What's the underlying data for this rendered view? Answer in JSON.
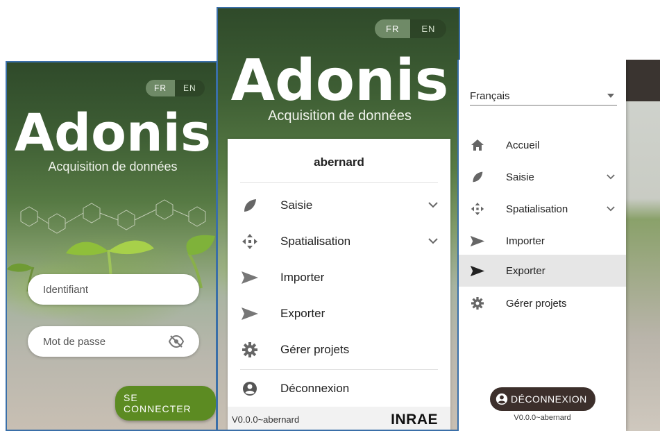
{
  "login": {
    "lang": [
      "FR",
      "EN"
    ],
    "brand": "Adonis",
    "tagline": "Acquisition de données",
    "username_placeholder": "Identifiant",
    "password_placeholder": "Mot de passe",
    "connect_label": "SE CONNECTER"
  },
  "drawer": {
    "lang": [
      "FR",
      "EN"
    ],
    "brand": "Adonis",
    "tagline": "Acquisition de données",
    "username": "abernard",
    "items": [
      {
        "label": "Saisie"
      },
      {
        "label": "Spatialisation"
      },
      {
        "label": "Importer"
      },
      {
        "label": "Exporter"
      },
      {
        "label": "Gérer projets"
      },
      {
        "label": "Déconnexion"
      }
    ],
    "version": "V0.0.0~abernard",
    "logo": "INRAE"
  },
  "sidenav": {
    "language_value": "Français",
    "items": [
      {
        "label": "Accueil"
      },
      {
        "label": "Saisie"
      },
      {
        "label": "Spatialisation"
      },
      {
        "label": "Importer"
      },
      {
        "label": "Exporter"
      },
      {
        "label": "Gérer projets"
      }
    ],
    "logout_label": "DÉCONNEXION",
    "version": "V0.0.0~abernard"
  },
  "colors": {
    "accent_green": "#5c8b22",
    "dark_button": "#3c2f2b",
    "selected_row": "#e6e6e6"
  }
}
